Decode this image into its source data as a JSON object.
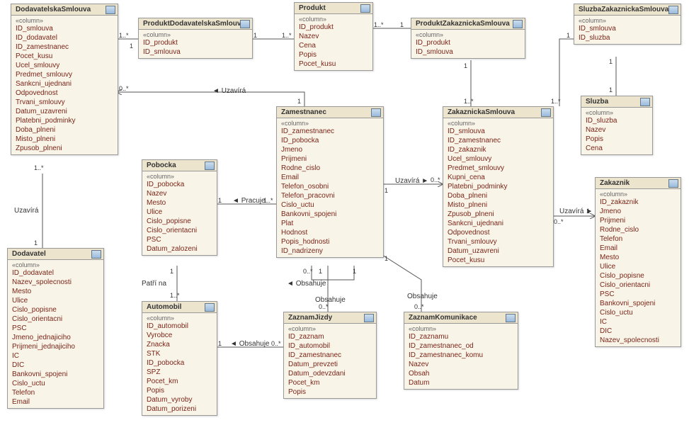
{
  "entities": {
    "dodavatelska_smlouva": {
      "title": "DodavatelskaSmlouva",
      "stereo": "«column»",
      "attrs": [
        "ID_smlouva",
        "ID_dodavatel",
        "ID_zamestnanec",
        "Pocet_kusu",
        "Ucel_smlouvy",
        "Predmet_smlouvy",
        "Sankcni_ujednani",
        "Odpovednost",
        "Trvani_smlouvy",
        "Datum_uzavreni",
        "Platebni_podminky",
        "Doba_plneni",
        "Misto_plneni",
        "Zpusob_plneni"
      ]
    },
    "produkt_dodavatelska_smlouva": {
      "title": "ProduktDodavatelskaSmlouva",
      "stereo": "«column»",
      "attrs": [
        "ID_produkt",
        "ID_smlouva"
      ]
    },
    "produkt": {
      "title": "Produkt",
      "stereo": "«column»",
      "attrs": [
        "ID_produkt",
        "Nazev",
        "Cena",
        "Popis",
        "Pocet_kusu"
      ]
    },
    "produkt_zakaznicka_smlouva": {
      "title": "ProduktZakaznickaSmlouva",
      "stereo": "«column»",
      "attrs": [
        "ID_produkt",
        "ID_smlouva"
      ]
    },
    "sluzba_zakaznicka_smlouva": {
      "title": "SluzbaZakaznickaSmlouva",
      "stereo": "«column»",
      "attrs": [
        "ID_smlouva",
        "ID_sluzba"
      ]
    },
    "sluzba": {
      "title": "Sluzba",
      "stereo": "«column»",
      "attrs": [
        "ID_sluzba",
        "Nazev",
        "Popis",
        "Cena"
      ]
    },
    "pobocka": {
      "title": "Pobocka",
      "stereo": "«column»",
      "attrs": [
        "ID_pobocka",
        "Nazev",
        "Mesto",
        "Ulice",
        "Cislo_popisne",
        "Cislo_orientacni",
        "PSC",
        "Datum_zalozeni"
      ]
    },
    "zamestnanec": {
      "title": "Zamestnanec",
      "stereo": "«column»",
      "attrs": [
        "ID_zamestnanec",
        "ID_pobocka",
        "Jmeno",
        "Prijmeni",
        "Rodne_cislo",
        "Email",
        "Telefon_osobni",
        "Telefon_pracovni",
        "Cislo_uctu",
        "Bankovni_spojeni",
        "Plat",
        "Hodnost",
        "Popis_hodnosti",
        "ID_nadrizeny"
      ]
    },
    "zakaznicka_smlouva": {
      "title": "ZakaznickaSmlouva",
      "stereo": "«column»",
      "attrs": [
        "ID_smlouva",
        "ID_zamestnanec",
        "ID_zakaznik",
        "Ucel_smlouvy",
        "Predmet_smlouvy",
        "Kupni_cena",
        "Platebni_podminky",
        "Doba_plneni",
        "Misto_plneni",
        "Zpusob_plneni",
        "Sankcni_ujednani",
        "Odpovednost",
        "Trvani_smlouvy",
        "Datum_uzavreni",
        "Pocet_kusu"
      ]
    },
    "zakaznik": {
      "title": "Zakaznik",
      "stereo": "«column»",
      "attrs": [
        "ID_zakaznik",
        "Jmeno",
        "Prijmeni",
        "Rodne_cislo",
        "Telefon",
        "Email",
        "Mesto",
        "Ulice",
        "Cislo_popisne",
        "Cislo_orientacni",
        "PSC",
        "Bankovni_spojeni",
        "Cislo_uctu",
        "IC",
        "DIC",
        "Nazev_spolecnosti"
      ]
    },
    "dodavatel": {
      "title": "Dodavatel",
      "stereo": "«column»",
      "attrs": [
        "ID_dodavatel",
        "Nazev_spolecnosti",
        "Mesto",
        "Ulice",
        "Cislo_popisne",
        "Cislo_orientacni",
        "PSC",
        "Jmeno_jednajiciho",
        "Prijmeni_jednajiciho",
        "IC",
        "DIC",
        "Bankovni_spojeni",
        "Cislo_uctu",
        "Telefon",
        "Email"
      ]
    },
    "automobil": {
      "title": "Automobil",
      "stereo": "«column»",
      "attrs": [
        "ID_automobil",
        "Vyrobce",
        "Znacka",
        "STK",
        "ID_pobocka",
        "SPZ",
        "Pocet_km",
        "Popis",
        "Datum_vyroby",
        "Datum_porizeni"
      ]
    },
    "zaznam_jizdy": {
      "title": "ZaznamJizdy",
      "stereo": "«column»",
      "attrs": [
        "ID_zaznam",
        "ID_automobil",
        "ID_zamestnanec",
        "Datum_prevzeti",
        "Datum_odevzdani",
        "Pocet_km",
        "Popis"
      ]
    },
    "zaznam_komunikace": {
      "title": "ZaznamKomunikace",
      "stereo": "«column»",
      "attrs": [
        "ID_zaznamu",
        "ID_zamestnanec_od",
        "ID_zamestnanec_komu",
        "Nazev",
        "Obsah",
        "Datum"
      ]
    }
  },
  "labels": {
    "uzavira": "Uzavírá",
    "pracuje": "Pracuje",
    "patri_na": "Patří na",
    "obsahuje": "Obsahuje"
  },
  "cards": {
    "one": "1",
    "one_many": "1..*",
    "zero_many": "0..*"
  }
}
